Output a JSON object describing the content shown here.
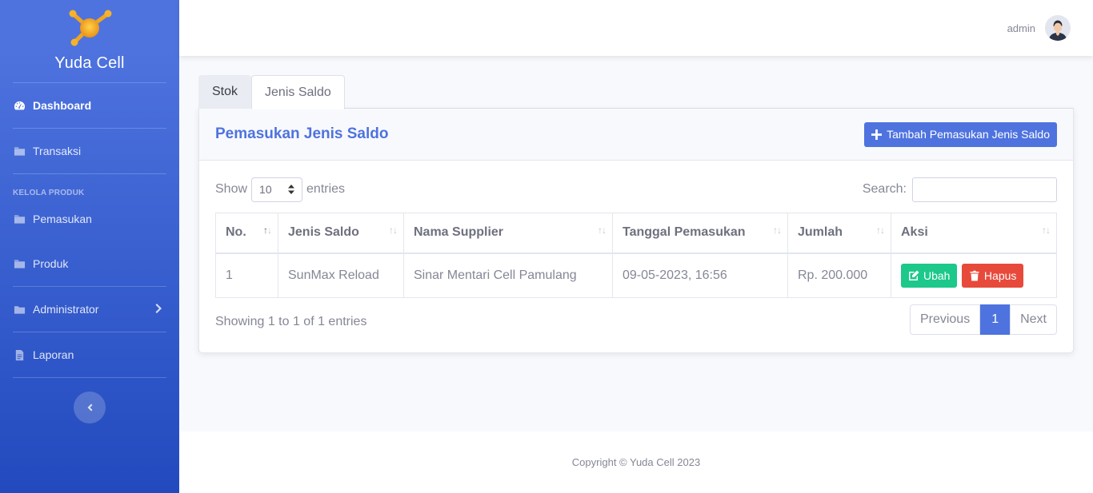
{
  "brand": {
    "name": "Yuda Cell"
  },
  "sidebar": {
    "items": [
      {
        "label": "Dashboard",
        "icon": "tachometer-icon",
        "active": true
      },
      {
        "label": "Transaksi",
        "icon": "folder-icon"
      }
    ],
    "heading": "KELOLA PRODUK",
    "items2": [
      {
        "label": "Pemasukan",
        "icon": "folder-icon"
      },
      {
        "label": "Produk",
        "icon": "folder-icon"
      },
      {
        "label": "Administrator",
        "icon": "folder-icon"
      },
      {
        "label": "Laporan",
        "icon": "file-icon"
      }
    ]
  },
  "topbar": {
    "user_name": "admin"
  },
  "tabs": [
    {
      "label": "Stok"
    },
    {
      "label": "Jenis Saldo",
      "active": true
    }
  ],
  "card": {
    "title": "Pemasukan Jenis Saldo",
    "add_button": "Tambah Pemasukan Jenis Saldo"
  },
  "datatable": {
    "show_label": "Show",
    "entries_label": "entries",
    "page_length": "10",
    "search_label": "Search:",
    "search_value": "",
    "columns": [
      "No.",
      "Jenis Saldo",
      "Nama Supplier",
      "Tanggal Pemasukan",
      "Jumlah",
      "Aksi"
    ],
    "rows": [
      {
        "no": "1",
        "jenis": "SunMax Reload",
        "supplier": "Sinar Mentari Cell Pamulang",
        "tanggal": "09-05-2023, 16:56",
        "jumlah": "Rp. 200.000"
      }
    ],
    "edit_label": "Ubah",
    "delete_label": "Hapus",
    "info": "Showing 1 to 1 of 1 entries",
    "prev_label": "Previous",
    "current_page": "1",
    "next_label": "Next"
  },
  "footer": {
    "copyright": "Copyright © Yuda Cell 2023"
  },
  "colors": {
    "primary": "#4e73df",
    "success": "#1cc88a",
    "danger": "#e74a3b"
  }
}
